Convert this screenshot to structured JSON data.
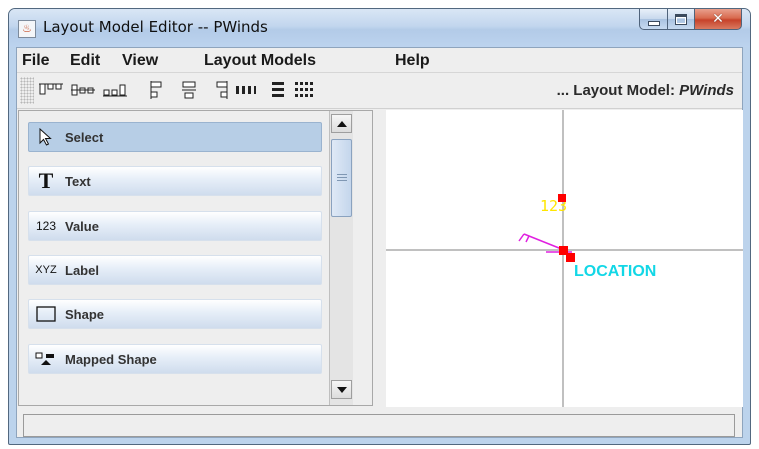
{
  "window": {
    "title": "Layout Model Editor -- PWinds"
  },
  "menubar": {
    "items": [
      "File",
      "Edit",
      "View",
      "Layout Models",
      "Help"
    ]
  },
  "toolbar": {
    "layout_model_prefix": "... Layout Model: ",
    "layout_model_name": "PWinds",
    "buttons": [
      "align-top-icon",
      "align-vcenter-icon",
      "align-bottom-icon",
      "align-left-icon",
      "align-hcenter-icon",
      "align-right-icon",
      "distribute-horizontal-icon",
      "distribute-vertical-icon",
      "grid-icon"
    ]
  },
  "palette": {
    "items": [
      {
        "label": "Select",
        "icon": "arrow-cursor-icon",
        "selected": true
      },
      {
        "label": "Text",
        "icon": "text-t-icon",
        "glyph": "T",
        "selected": false
      },
      {
        "label": "Value",
        "icon": "value-icon",
        "glyph": "123",
        "selected": false
      },
      {
        "label": "Label",
        "icon": "label-icon",
        "glyph": "XYZ",
        "selected": false
      },
      {
        "label": "Shape",
        "icon": "rectangle-icon",
        "selected": false
      },
      {
        "label": "Mapped Shape",
        "icon": "mapped-shape-icon",
        "selected": false
      }
    ]
  },
  "canvas": {
    "value_text": "123",
    "value_color": "#ffe600",
    "label_text": "LOCATION",
    "label_color": "#12d7e6",
    "marker_color": "#ff0000",
    "wind_color": "#e020e0",
    "crosshair_color": "#808080"
  }
}
